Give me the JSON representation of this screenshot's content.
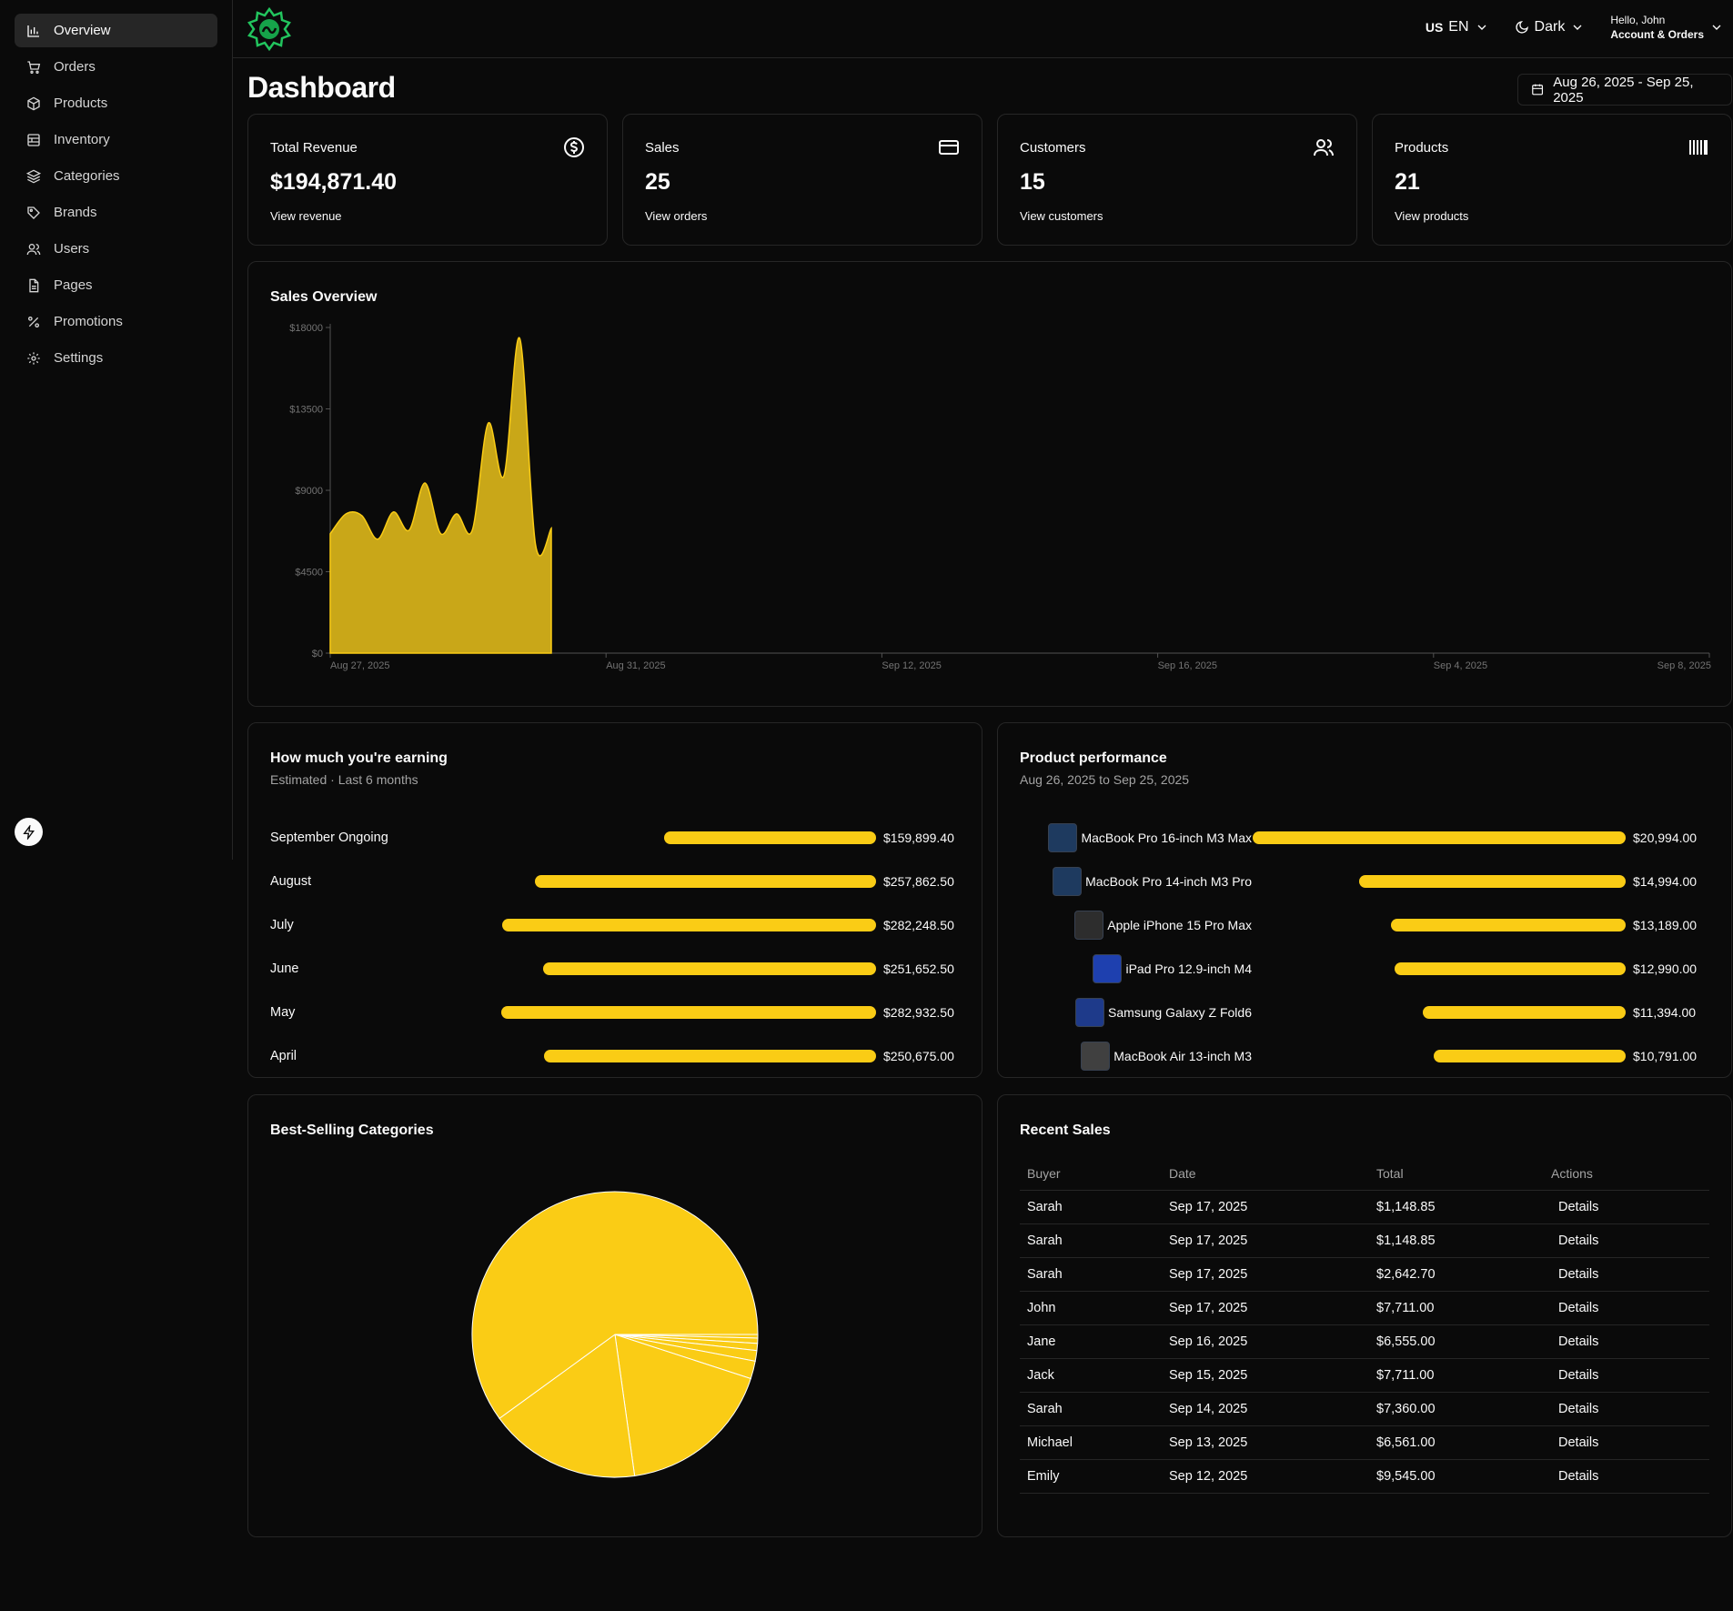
{
  "sidebar": {
    "items": [
      {
        "label": "Overview",
        "icon": "bar-chart-icon"
      },
      {
        "label": "Orders",
        "icon": "cart-icon"
      },
      {
        "label": "Products",
        "icon": "package-icon"
      },
      {
        "label": "Inventory",
        "icon": "inventory-icon"
      },
      {
        "label": "Categories",
        "icon": "layers-icon"
      },
      {
        "label": "Brands",
        "icon": "tag-icon"
      },
      {
        "label": "Users",
        "icon": "users-icon"
      },
      {
        "label": "Pages",
        "icon": "file-icon"
      },
      {
        "label": "Promotions",
        "icon": "percent-icon"
      },
      {
        "label": "Settings",
        "icon": "gear-icon"
      }
    ]
  },
  "header": {
    "lang_code": "US",
    "lang": "EN",
    "theme": "Dark",
    "greeting": "Hello, John",
    "account": "Account & Orders"
  },
  "page": {
    "title": "Dashboard",
    "date_range": "Aug 26, 2025 - Sep 25, 2025"
  },
  "stats": [
    {
      "label": "Total Revenue",
      "value": "$194,871.40",
      "link": "View revenue",
      "icon": "dollar-circle-icon"
    },
    {
      "label": "Sales",
      "value": "25",
      "link": "View orders",
      "icon": "credit-card-icon"
    },
    {
      "label": "Customers",
      "value": "15",
      "link": "View customers",
      "icon": "users-icon"
    },
    {
      "label": "Products",
      "value": "21",
      "link": "View products",
      "icon": "barcode-icon"
    }
  ],
  "sales_overview": {
    "title": "Sales Overview"
  },
  "chart_data": [
    {
      "type": "area",
      "title": "Sales Overview",
      "ylim": [
        0,
        18000
      ],
      "yticks": [
        "$18000",
        "$13500",
        "$9000",
        "$4500",
        "$0"
      ],
      "xticks": [
        "Aug 27, 2025",
        "Aug 31, 2025",
        "Sep 12, 2025",
        "Sep 16, 2025",
        "Sep 4, 2025",
        "Sep 8, 2025"
      ],
      "grid": false,
      "color": "#c9a718",
      "series": [
        {
          "values": [
            6600,
            7700,
            7600,
            6300,
            7800,
            6800,
            9400,
            6600,
            7700,
            6800,
            12700,
            9800,
            17400,
            6000,
            6900
          ]
        }
      ]
    },
    {
      "type": "pie",
      "title": "Best-Selling Categories",
      "color": "#facc15",
      "values": [
        60.0,
        17.2,
        17.8,
        2.0,
        1.2,
        0.8,
        0.6,
        0.4
      ]
    }
  ],
  "earnings": {
    "title": "How much you're earning",
    "subtitle": "Estimated · Last 6 months",
    "rows": [
      {
        "label": "September Ongoing",
        "value": "$159,899.40",
        "amount": 159899.4
      },
      {
        "label": "August",
        "value": "$257,862.50",
        "amount": 257862.5
      },
      {
        "label": "July",
        "value": "$282,248.50",
        "amount": 282248.5
      },
      {
        "label": "June",
        "value": "$251,652.50",
        "amount": 251652.5
      },
      {
        "label": "May",
        "value": "$282,932.50",
        "amount": 282932.5
      },
      {
        "label": "April",
        "value": "$250,675.00",
        "amount": 250675.0
      }
    ]
  },
  "performance": {
    "title": "Product performance",
    "subtitle": "Aug 26, 2025 to Sep 25, 2025",
    "rows": [
      {
        "label": "MacBook Pro 16-inch M3 Max",
        "value": "$20,994.00",
        "amount": 20994
      },
      {
        "label": "MacBook Pro 14-inch M3 Pro",
        "value": "$14,994.00",
        "amount": 14994
      },
      {
        "label": "Apple iPhone 15 Pro Max",
        "value": "$13,189.00",
        "amount": 13189
      },
      {
        "label": "iPad Pro 12.9-inch M4",
        "value": "$12,990.00",
        "amount": 12990
      },
      {
        "label": "Samsung Galaxy Z Fold6",
        "value": "$11,394.00",
        "amount": 11394
      },
      {
        "label": "MacBook Air 13-inch M3",
        "value": "$10,791.00",
        "amount": 10791
      }
    ]
  },
  "categories": {
    "title": "Best-Selling Categories"
  },
  "recent_sales": {
    "title": "Recent Sales",
    "columns": [
      "Buyer",
      "Date",
      "Total",
      "Actions"
    ],
    "rows": [
      [
        "Sarah",
        "Sep 17, 2025",
        "$1,148.85",
        "Details"
      ],
      [
        "Sarah",
        "Sep 17, 2025",
        "$1,148.85",
        "Details"
      ],
      [
        "Sarah",
        "Sep 17, 2025",
        "$2,642.70",
        "Details"
      ],
      [
        "John",
        "Sep 17, 2025",
        "$7,711.00",
        "Details"
      ],
      [
        "Jane",
        "Sep 16, 2025",
        "$6,555.00",
        "Details"
      ],
      [
        "Jack",
        "Sep 15, 2025",
        "$7,711.00",
        "Details"
      ],
      [
        "Sarah",
        "Sep 14, 2025",
        "$7,360.00",
        "Details"
      ],
      [
        "Michael",
        "Sep 13, 2025",
        "$6,561.00",
        "Details"
      ],
      [
        "Emily",
        "Sep 12, 2025",
        "$9,545.00",
        "Details"
      ]
    ]
  }
}
